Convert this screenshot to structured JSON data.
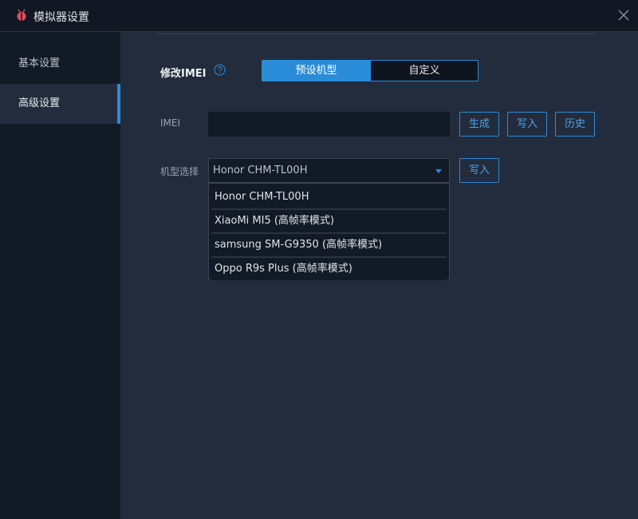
{
  "window": {
    "title": "模拟器设置",
    "app_icon": "bug-icon",
    "close_icon": "close-icon"
  },
  "sidebar": {
    "items": [
      {
        "label": "基本设置",
        "active": false
      },
      {
        "label": "高级设置",
        "active": true
      }
    ]
  },
  "imei_section": {
    "label": "修改IMEI",
    "help_icon": "question-circle-icon",
    "segments": [
      {
        "label": "预设机型",
        "selected": true
      },
      {
        "label": "自定义",
        "selected": false
      }
    ]
  },
  "imei_field": {
    "label": "IMEI",
    "value": "",
    "buttons": {
      "generate": "生成",
      "write": "写入",
      "history": "历史"
    }
  },
  "model_field": {
    "label": "机型选择",
    "selected": "Honor CHM-TL00H",
    "write_button": "写入",
    "options": [
      "Honor CHM-TL00H",
      "XiaoMi MI5 (高帧率模式)",
      "samsung SM-G9350 (高帧率模式)",
      "Oppo R9s Plus (高帧率模式)"
    ]
  },
  "colors": {
    "accent": "#2a8bd8",
    "window_bg": "#232c3c",
    "sidebar_bg": "#121a26",
    "titlebar_bg": "#111823",
    "logo": "#e0505e"
  }
}
